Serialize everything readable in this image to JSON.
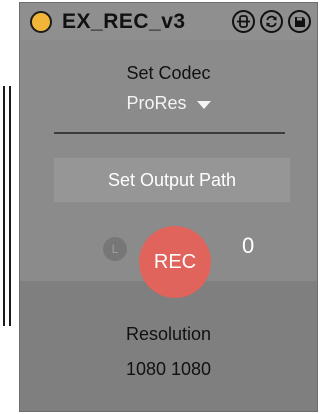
{
  "colors": {
    "device_bg": "#8b8b8b",
    "power_on": "#f2b53a",
    "rec_button": "#e0645b",
    "text_dark": "#111111",
    "text_light": "#ffffff"
  },
  "header": {
    "title": "EX_REC_v3",
    "icons": [
      "link-icon",
      "refresh-icon",
      "save-icon"
    ]
  },
  "codec": {
    "label": "Set Codec",
    "value": "ProRes"
  },
  "output": {
    "button_label": "Set Output Path"
  },
  "record": {
    "l_label": "L",
    "rec_label": "REC",
    "counter": "0"
  },
  "resolution": {
    "label": "Resolution",
    "value": "1080 1080"
  }
}
